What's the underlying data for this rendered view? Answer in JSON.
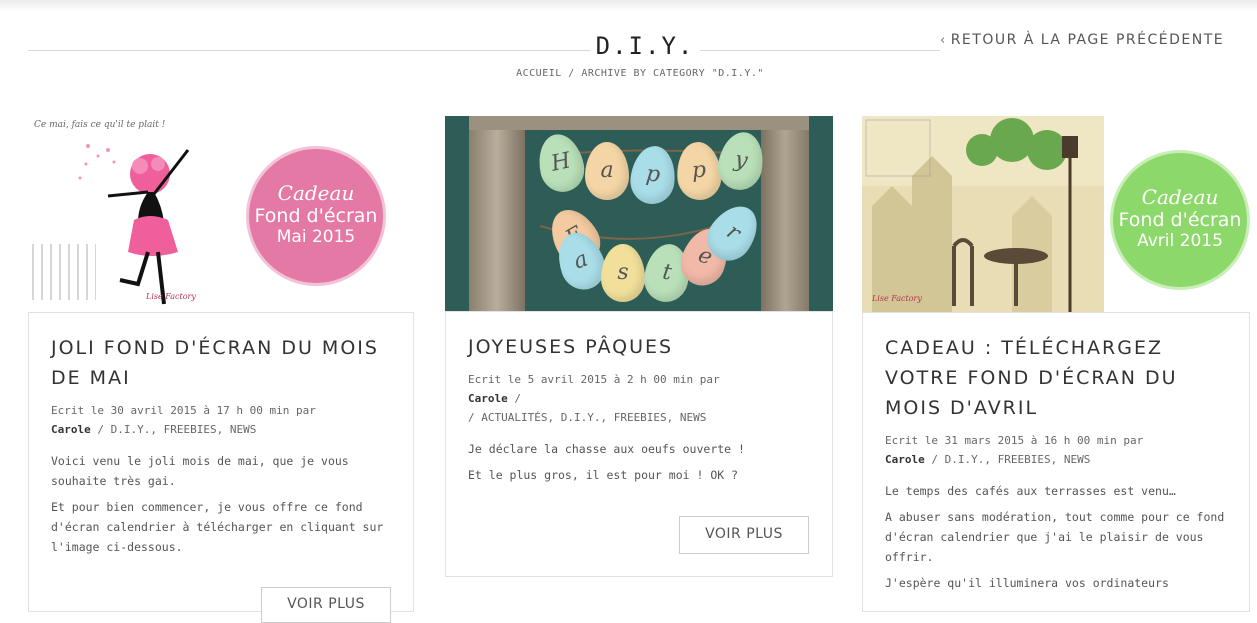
{
  "header": {
    "title": "D.I.Y.",
    "back_link": "RETOUR À LA PAGE PRÉCÉDENTE",
    "breadcrumb": "ACCUEIL / ARCHIVE BY CATEGORY \"D.I.Y.\""
  },
  "posts": [
    {
      "title": "JOLI FOND D'ÉCRAN DU MOIS DE MAI",
      "meta": "Ecrit le 30 avril 2015 à 17 h 00 min par",
      "author": "Carole",
      "categories": " / D.I.Y., FREEBIES, NEWS",
      "excerpt": [
        "Voici venu le joli mois de mai, que je vous souhaite très gai.",
        "Et pour bien commencer, je vous offre ce fond d'écran calendrier à télécharger en cliquant sur l'image ci-dessous."
      ],
      "button": "VOIR PLUS",
      "image": {
        "badge_line1": "Cadeau",
        "badge_line2": "Fond d'écran",
        "badge_line3": "Mai 2015",
        "badge_color": "#e579a6",
        "script_text": "Ce mai, fais ce qu'il te plait !",
        "signature": "Lise Factory"
      }
    },
    {
      "title": "JOYEUSES PÂQUES",
      "meta": "Ecrit le 5 avril 2015 à 2 h 00 min par",
      "author": "Carole",
      "categories": " / ACTUALITÉS, D.I.Y., FREEBIES, NEWS",
      "excerpt": [
        "Je déclare la chasse aux oeufs ouverte !",
        "Et le plus gros, il est pour moi ! OK ?"
      ],
      "button": "VOIR PLUS",
      "image": {
        "letters": [
          "H",
          "a",
          "p",
          "p",
          "y",
          "E",
          "a",
          "s",
          "t",
          "e",
          "r"
        ]
      }
    },
    {
      "title": "CADEAU : TÉLÉCHARGEZ VOTRE FOND D'ÉCRAN DU MOIS D'AVRIL",
      "meta": "Ecrit le 31 mars 2015 à 16 h 00 min par",
      "author": "Carole",
      "categories": " / D.I.Y., FREEBIES, NEWS",
      "excerpt": [
        "Le temps des cafés aux terrasses est venu…",
        "A abuser sans modération, tout comme pour ce fond d'écran calendrier que j'ai le plaisir de vous offrir.",
        "J'espère qu'il illuminera vos ordinateurs"
      ],
      "image": {
        "badge_line1": "Cadeau",
        "badge_line2": "Fond d'écran",
        "badge_line3": "Avril 2015",
        "badge_color": "#8dd86a",
        "signature": "Lise Factory"
      }
    }
  ],
  "colors": {
    "accent_pink": "#e579a6",
    "accent_green": "#8dd86a",
    "text": "#333333",
    "border": "#e2e2e2"
  }
}
